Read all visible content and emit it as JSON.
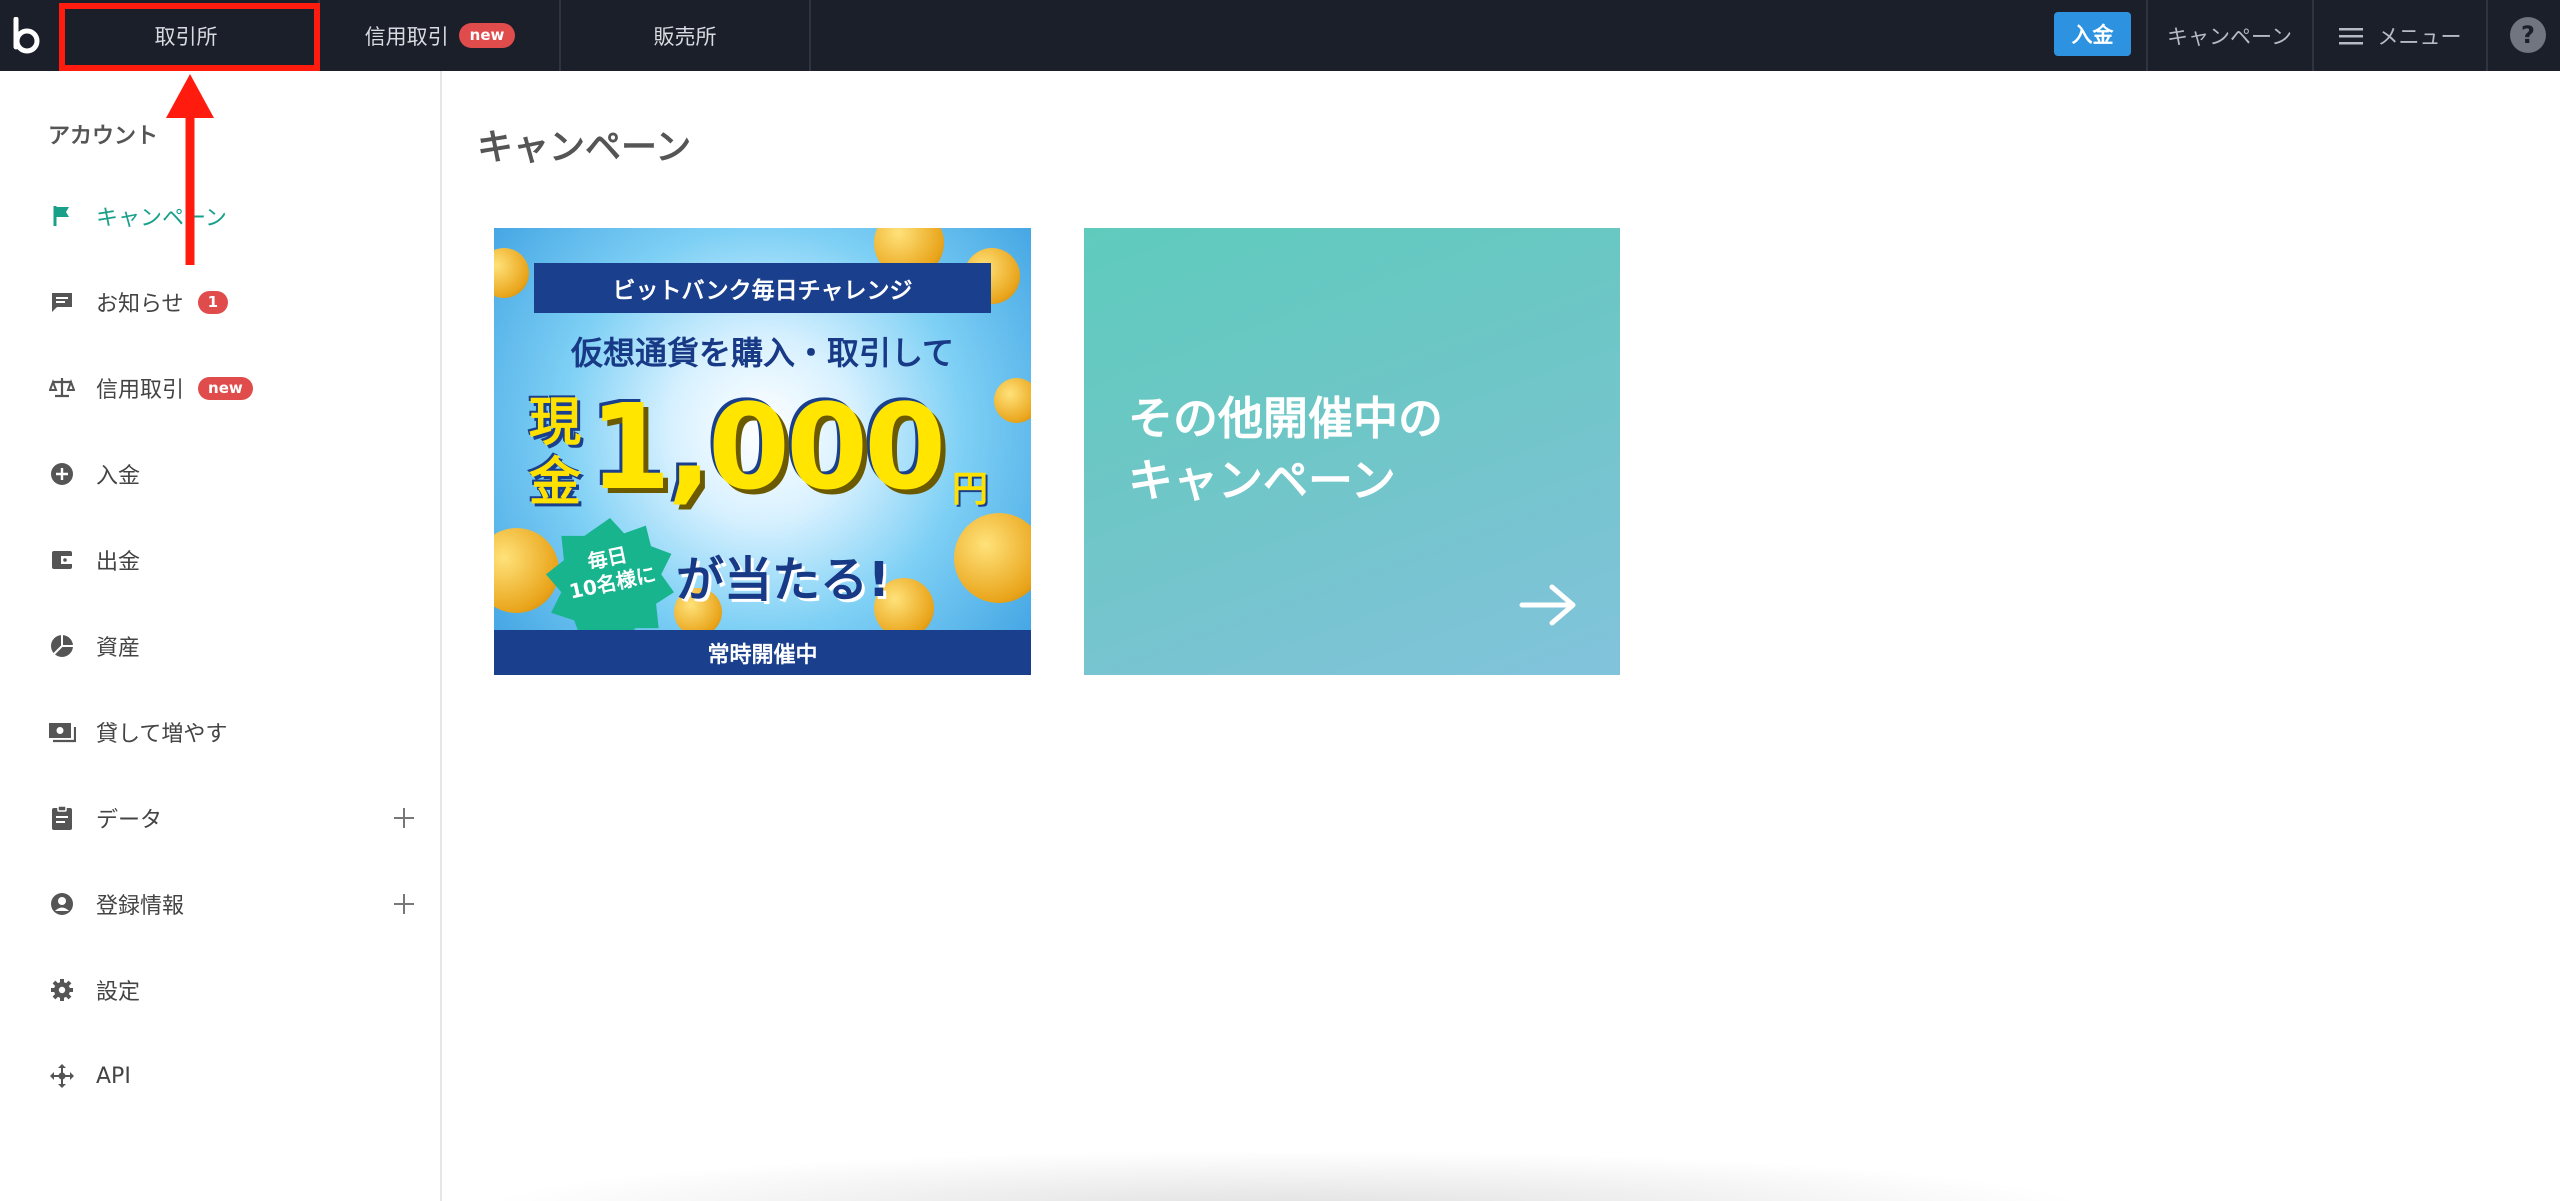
{
  "topbar": {
    "tabs": [
      {
        "label": "取引所"
      },
      {
        "label": "信用取引",
        "badge": "new"
      },
      {
        "label": "販売所"
      }
    ],
    "deposit_button": "入金",
    "campaign_link": "キャンペーン",
    "menu_link": "メニュー",
    "help": "?"
  },
  "sidebar": {
    "heading": "アカウント",
    "items": [
      {
        "label": "キャンペーン",
        "icon": "flag-icon",
        "active": true
      },
      {
        "label": "お知らせ",
        "icon": "message-icon",
        "badge": "1"
      },
      {
        "label": "信用取引",
        "icon": "scale-icon",
        "badge": "new"
      },
      {
        "label": "入金",
        "icon": "plus-circle-icon"
      },
      {
        "label": "出金",
        "icon": "wallet-icon"
      },
      {
        "label": "資産",
        "icon": "pie-chart-icon"
      },
      {
        "label": "貸して増やす",
        "icon": "lend-icon"
      },
      {
        "label": "データ",
        "icon": "clipboard-icon",
        "expandable": true
      },
      {
        "label": "登録情報",
        "icon": "account-icon",
        "expandable": true
      },
      {
        "label": "設定",
        "icon": "gear-icon"
      },
      {
        "label": "API",
        "icon": "api-icon"
      }
    ]
  },
  "main": {
    "title": "キャンペーン",
    "banner1": {
      "ribbon": "ビットバンク毎日チャレンジ",
      "subtitle": "仮想通貨を購入・取引して",
      "genkin": "現金",
      "amount": "1,000",
      "yen": "円",
      "star_line1": "毎日",
      "star_line2": "10名様に",
      "ataru": "が当たる!",
      "footer": "常時開催中"
    },
    "banner2": {
      "line1": "その他開催中の",
      "line2": "キャンペーン"
    }
  },
  "colors": {
    "topbar_bg": "#1b1f2a",
    "accent_green": "#18a08a",
    "badge_red": "#e04b4b",
    "deposit_blue": "#2d93e0",
    "highlight_red": "#ff1c0f"
  }
}
